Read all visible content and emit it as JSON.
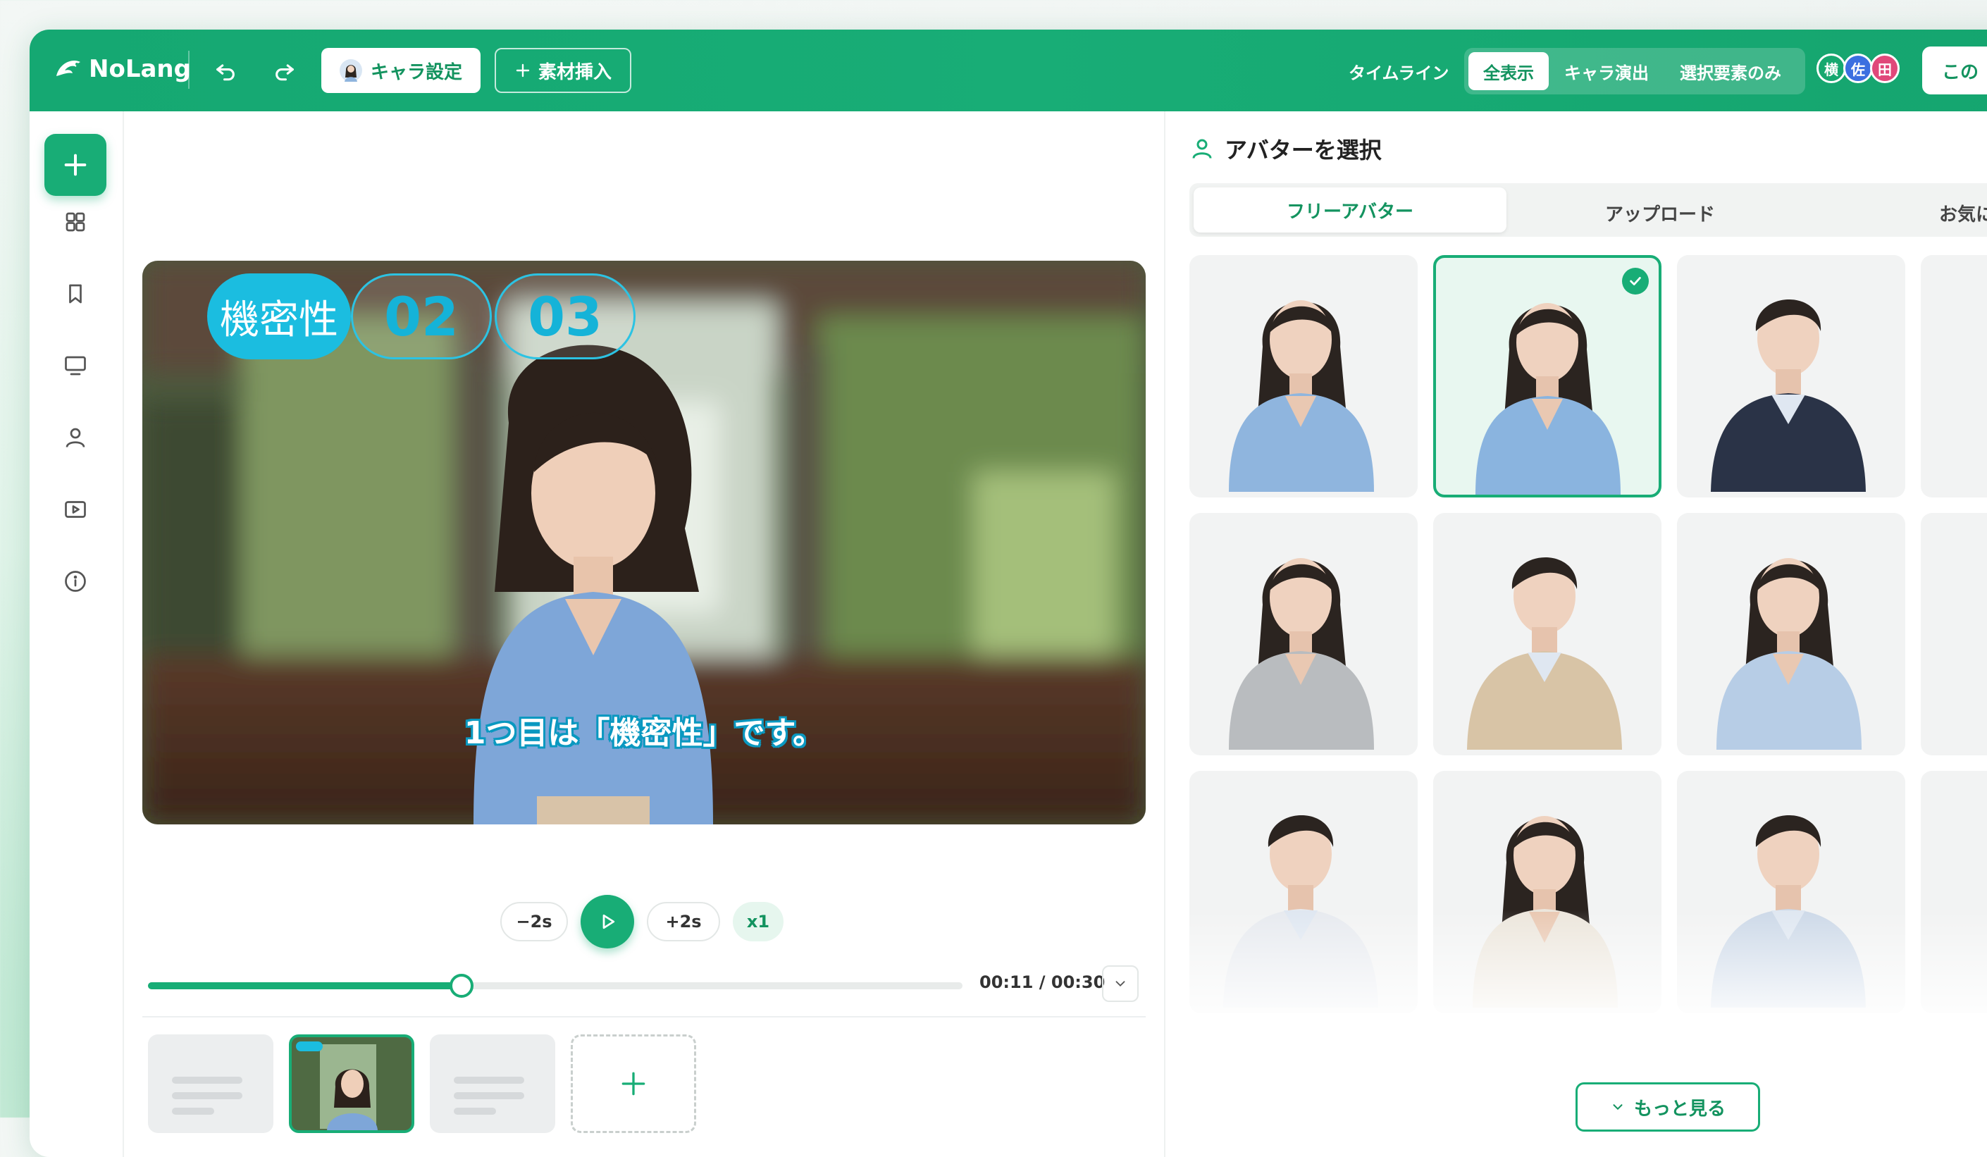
{
  "app": {
    "logo": "NoLang"
  },
  "toolbar": {
    "chara_label": "キャラ設定",
    "insert_label": "素材挿入",
    "timeline_label": "タイムライン",
    "filters": [
      {
        "label": "全表示",
        "active": true
      },
      {
        "label": "キャラ演出",
        "active": false
      },
      {
        "label": "選択要素のみ",
        "active": false
      }
    ],
    "collaborators": [
      {
        "initial": "横",
        "color": "#16a86f"
      },
      {
        "initial": "佐",
        "color": "#3b6fe0"
      },
      {
        "initial": "田",
        "color": "#e0487a"
      }
    ],
    "primary_label": "この"
  },
  "preview": {
    "chapters": [
      {
        "label": "機密性",
        "active": true
      },
      {
        "label": "02",
        "active": false
      },
      {
        "label": "03",
        "active": false
      }
    ],
    "subtitle": "1つ目は「機密性」です。"
  },
  "player": {
    "back_label": "−2s",
    "forward_label": "+2s",
    "speed_label": "x1",
    "time": "00:11 / 00:30",
    "progress": 0.385
  },
  "avatar_panel": {
    "title": "アバターを選択",
    "tabs": [
      {
        "label": "フリーアバター",
        "active": true
      },
      {
        "label": "アップロード",
        "active": false
      },
      {
        "label": "お気に",
        "active": false
      }
    ],
    "avatars": [
      {
        "kind": "woman",
        "outfit": "#8fb5de",
        "selected": false
      },
      {
        "kind": "woman",
        "outfit": "#8ab4df",
        "selected": true
      },
      {
        "kind": "man",
        "outfit": "#2a3347",
        "selected": false
      },
      {
        "kind": "woman",
        "outfit": "#b9bcbf",
        "selected": false
      },
      {
        "kind": "man",
        "outfit": "#d8c4a6",
        "selected": false
      },
      {
        "kind": "woman",
        "outfit": "#b7cde6",
        "selected": false
      },
      {
        "kind": "man",
        "outfit": "#e7eaef",
        "selected": false
      },
      {
        "kind": "woman",
        "outfit": "#ece6dc",
        "selected": false
      },
      {
        "kind": "man",
        "outfit": "#cdd9e8",
        "selected": false
      }
    ],
    "more_label": "もっと見る"
  }
}
